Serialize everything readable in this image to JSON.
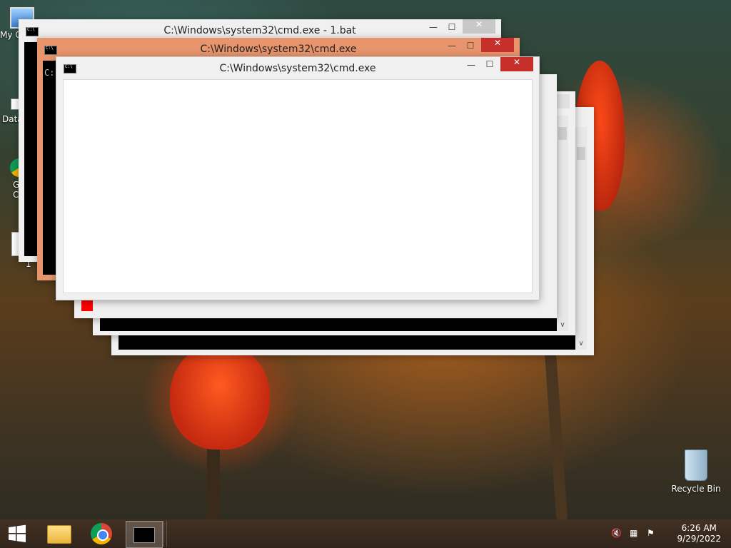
{
  "desktop": {
    "icons": [
      {
        "label": "My C",
        "name": "my-computer"
      },
      {
        "label": "Data",
        "name": "data-shortcut"
      },
      {
        "label": "G\nC",
        "name": "google-chrome-shortcut"
      },
      {
        "label": "1",
        "name": "file-1"
      }
    ],
    "recycle_bin": {
      "label": "Recycle Bin"
    }
  },
  "windows": [
    {
      "id": "w1",
      "title": "C:\\Windows\\system32\\cmd.exe - 1.bat",
      "state": "inactive"
    },
    {
      "id": "w2",
      "title": "C:\\Windows\\system32\\cmd.exe",
      "state": "inactive-orange"
    },
    {
      "id": "w3",
      "title": "C:\\Windows\\system32\\cmd.exe",
      "state": "active"
    }
  ],
  "window_controls": {
    "minimize": "—",
    "maximize": "☐",
    "close": "✕"
  },
  "prompt_fragments": {
    "w1": "",
    "w2": "C:"
  },
  "taskbar": {
    "start": "start",
    "pinned": [
      "file-explorer",
      "google-chrome",
      "command-prompt"
    ],
    "clock": {
      "time": "6:26 AM",
      "date": "9/29/2022"
    }
  },
  "colors": {
    "active_close": "#c7302a",
    "orange_frame": "#e8946c",
    "inactive_frame": "#f0f0f0"
  }
}
